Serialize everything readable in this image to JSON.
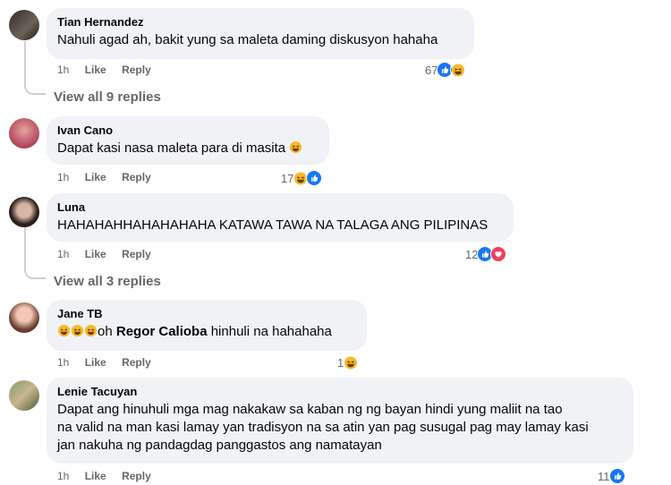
{
  "comments": [
    {
      "author": "Tian Hernandez",
      "text": "Nahuli agad ah, bakit yung sa maleta daming diskusyon hahaha",
      "time": "1h",
      "like_label": "Like",
      "reply_label": "Reply",
      "reaction_count": "67",
      "reactions": [
        "like-icon",
        "haha-icon"
      ],
      "view_replies": "View all 9 replies"
    },
    {
      "author": "Ivan Cano",
      "text": "Dapat kasi nasa maleta para di masita",
      "time": "1h",
      "like_label": "Like",
      "reply_label": "Reply",
      "reaction_count": "17",
      "reactions": [
        "haha-icon",
        "like-icon"
      ]
    },
    {
      "author": "Luna",
      "text": "HAHAHAHHAHAHAHAHA KATAWA TAWA NA TALAGA ANG PILIPINAS",
      "time": "1h",
      "like_label": "Like",
      "reply_label": "Reply",
      "reaction_count": "12",
      "reactions": [
        "like-icon",
        "love-icon"
      ],
      "view_replies": "View all 3 replies"
    },
    {
      "author": "Jane TB",
      "text_prefix": "oh",
      "mention": "Regor Calioba",
      "text_suffix": "hinhuli na hahahaha",
      "time": "1h",
      "like_label": "Like",
      "reply_label": "Reply",
      "reaction_count": "1",
      "reactions": [
        "haha-icon"
      ]
    },
    {
      "author": "Lenie Tacuyan",
      "text_lines": [
        "Dapat ang hinuhuli mga mag nakakaw sa kaban ng ng bayan hindi yung maliit na tao",
        "na valid na man kasi lamay yan tradisyon na sa atin yan pag susugal pag may lamay kasi",
        "jan nakuha ng pandagdag panggastos ang namatayan"
      ],
      "time": "1h",
      "like_label": "Like",
      "reply_label": "Reply",
      "reaction_count": "11",
      "reactions": [
        "like-icon"
      ]
    }
  ],
  "colors": {
    "bubble": "#f0f2f5",
    "secondary_text": "#65676b",
    "like_blue": "#1877f2",
    "haha_yellow": "#f7b928",
    "love_red": "#f33e58"
  }
}
